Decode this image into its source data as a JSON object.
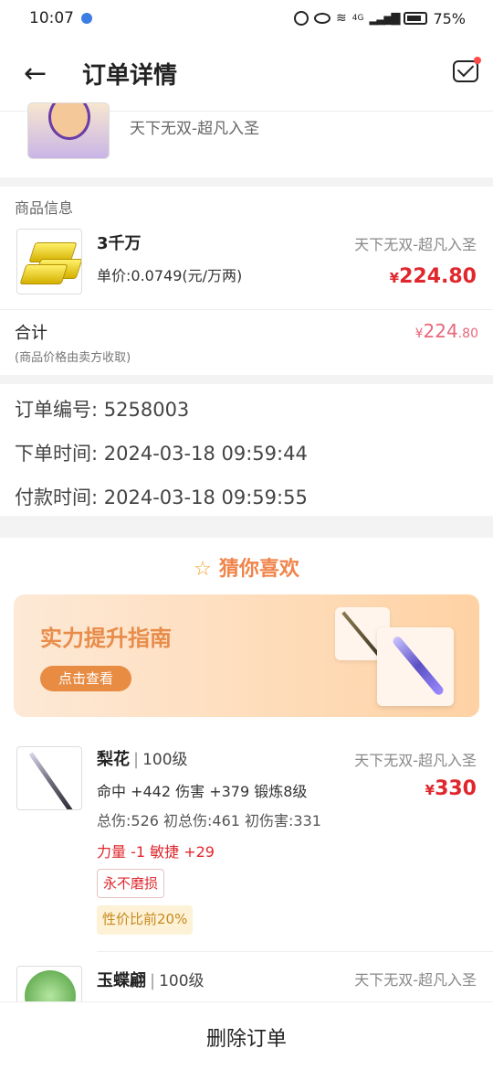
{
  "status_bar": {
    "time": "10:07",
    "battery": "75%",
    "network": "4G"
  },
  "header": {
    "title": "订单详情"
  },
  "seller": {
    "server": "天下无双-超凡入圣"
  },
  "goods": {
    "section_label": "商品信息",
    "item": {
      "name": "3千万",
      "server": "天下无双-超凡入圣",
      "unit_price": "单价:0.0749(元/万两)",
      "price_symbol": "¥",
      "price": "224.80"
    },
    "total": {
      "label": "合计",
      "note": "(商品价格由卖方收取)",
      "symbol": "¥",
      "integer": "224",
      "decimal": ".80"
    }
  },
  "order_info": {
    "number_label": "订单编号:",
    "number_value": "5258003",
    "created_label": "下单时间:",
    "created_value": "2024-03-18 09:59:44",
    "paid_label": "付款时间:",
    "paid_value": "2024-03-18 09:59:55"
  },
  "recommend": {
    "title": "猜你喜欢",
    "banner": {
      "title": "实力提升指南",
      "button": "点击查看"
    },
    "items": [
      {
        "name": "梨花",
        "level": "100级",
        "server": "天下无双-超凡入圣",
        "stats1": "命中 +442 伤害 +379 锻炼8级",
        "stats2": "总伤:526 初总伤:461 初伤害:331",
        "stats3": "力量 -1 敏捷 +29",
        "tag1": "永不磨损",
        "tag2": "性价比前20%",
        "price_symbol": "¥",
        "price": "330"
      },
      {
        "name": "玉蝶翩",
        "level": "100级",
        "server": "天下无双-超凡入圣"
      }
    ]
  },
  "bottom": {
    "delete_label": "删除订单"
  },
  "colors": {
    "price_red": "#e0272d",
    "accent_orange": "#f0844a",
    "total_pink": "#e8677a"
  }
}
